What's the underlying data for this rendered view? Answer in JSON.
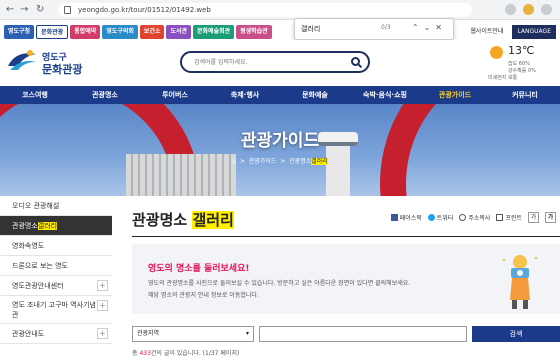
{
  "browser": {
    "url": "yeongdo.go.kr/tour/01512/01492.web",
    "find": {
      "query": "갤러리",
      "count": "0/3"
    }
  },
  "topbar": {
    "site_tabs": [
      {
        "label": "영도구청",
        "color": "#2d5fb3"
      },
      {
        "label": "문화관광",
        "color": "#ffffff"
      },
      {
        "label": "통합예약",
        "color": "#d23c6a"
      },
      {
        "label": "영도구의회",
        "color": "#2a8bc9"
      },
      {
        "label": "보건소",
        "color": "#e0442f"
      },
      {
        "label": "도서관",
        "color": "#8a4fc2"
      },
      {
        "label": "문화예술회관",
        "color": "#1b9e77"
      },
      {
        "label": "평생학습관",
        "color": "#c94f8a"
      }
    ],
    "sitemap": "웹사이트안내",
    "language": "LANGUAGE"
  },
  "header": {
    "logo_line1": "영도구",
    "logo_line2": "문화관광",
    "search_placeholder": "검색어를 입력하세요."
  },
  "weather": {
    "temp": "13℃",
    "line1": "습도 60%",
    "line2": "강수확률 0%",
    "line3": "미세먼지 보통"
  },
  "mainnav": [
    "코스여행",
    "관광명소",
    "투어버스",
    "축제·행사",
    "문화예술",
    "숙박·음식·쇼핑",
    "관광가이드",
    "커뮤니티"
  ],
  "hero": {
    "title": "관광가이드",
    "bc_home": "⌂",
    "bc_1": "관광가이드",
    "bc_2": "관광명소",
    "bc_2_hl": "갤러리"
  },
  "sidebar": [
    {
      "label": "오디오 관광해설",
      "has_plus": false
    },
    {
      "label": "관광명소",
      "label_hl": "갤러리",
      "active": true
    },
    {
      "label": "영화속영도",
      "has_plus": false
    },
    {
      "label": "드론으로 보는 영도",
      "has_plus": false
    },
    {
      "label": "영도관광안내센터",
      "has_plus": true
    },
    {
      "label": "영도 조내기 고구마 역사기념관",
      "has_plus": true,
      "tall": true
    },
    {
      "label": "관광안내도",
      "has_plus": true
    }
  ],
  "content": {
    "title_prefix": "관광명소 ",
    "title_hl": "갤러리",
    "share": {
      "facebook": "페이스북",
      "twitter": "트위터",
      "copy": "주소복사",
      "print": "프린트",
      "font_minus": "가",
      "font_plus": "가"
    },
    "info_heading": "영도의 명소를 둘러보세요!",
    "info_line1": "영도의 관광명소를 사진으로 둘러보실 수 있습니다. 방문하고 싶은 아름다운 장면이 있다면 클릭해보세요.",
    "info_line2": "해당 명소의 관광지 안내 정보로 이동합니다.",
    "filter_select": "관광지역",
    "filter_input": "",
    "filter_button": "검색",
    "count_prefix": "총 ",
    "count_num": "433",
    "count_suffix": "건의 글이 있습니다. (1/37 페이지)"
  },
  "colors": {
    "nav": "#1c3a8a",
    "accent_pink": "#e4125b",
    "highlight": "#ffee00"
  }
}
